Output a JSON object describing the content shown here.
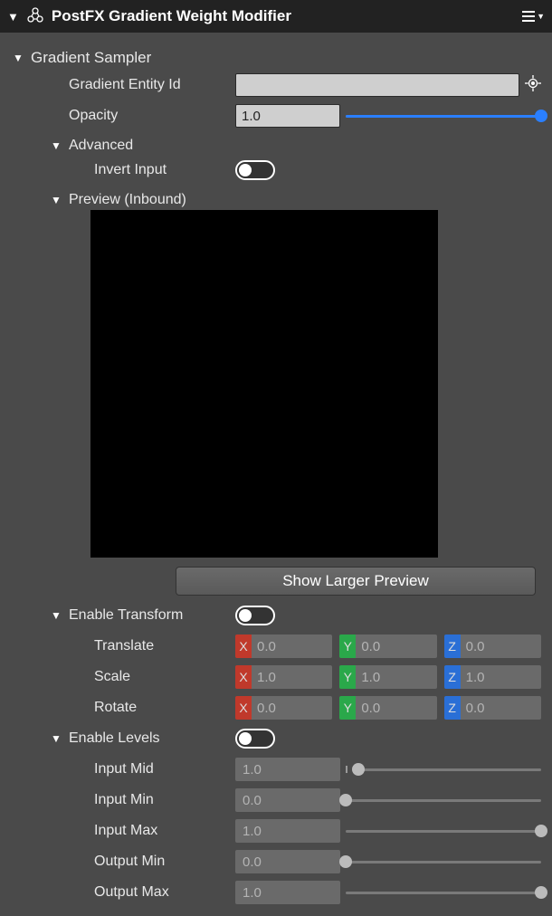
{
  "header": {
    "title": "PostFX Gradient Weight Modifier"
  },
  "main": {
    "title": "Gradient Sampler",
    "gradient_id_label": "Gradient Entity Id",
    "gradient_id_value": "",
    "opacity_label": "Opacity",
    "opacity_value": "1.0",
    "advanced_label": "Advanced",
    "invert_label": "Invert Input",
    "preview_label": "Preview (Inbound)",
    "show_preview_btn": "Show Larger Preview"
  },
  "transform": {
    "enable_label": "Enable Transform",
    "translate_label": "Translate",
    "scale_label": "Scale",
    "rotate_label": "Rotate",
    "translate": {
      "x": "0.0",
      "y": "0.0",
      "z": "0.0"
    },
    "scale": {
      "x": "1.0",
      "y": "1.0",
      "z": "1.0"
    },
    "rotate": {
      "x": "0.0",
      "y": "0.0",
      "z": "0.0"
    },
    "axis": {
      "x": "X",
      "y": "Y",
      "z": "Z"
    }
  },
  "levels": {
    "enable_label": "Enable Levels",
    "input_mid_label": "Input Mid",
    "input_min_label": "Input Min",
    "input_max_label": "Input Max",
    "output_min_label": "Output Min",
    "output_max_label": "Output Max",
    "input_mid": "1.0",
    "input_min": "0.0",
    "input_max": "1.0",
    "output_min": "0.0",
    "output_max": "1.0"
  }
}
